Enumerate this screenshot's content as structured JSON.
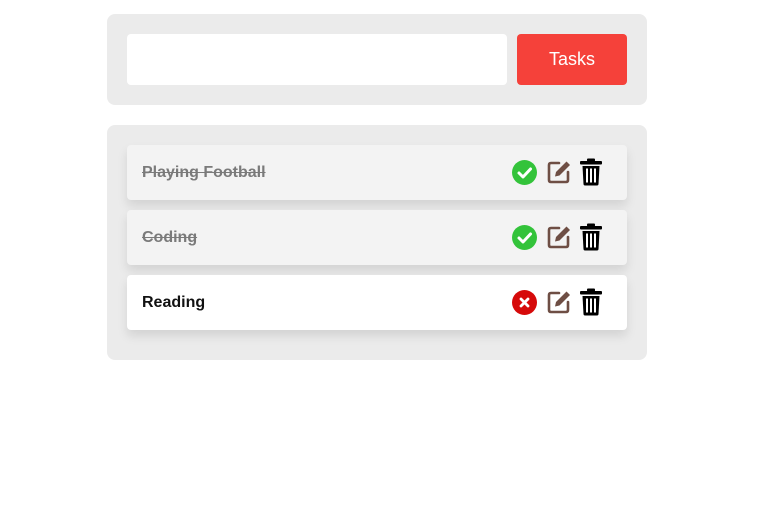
{
  "input": {
    "value": "",
    "placeholder": ""
  },
  "add_button": {
    "label": "Tasks"
  },
  "tasks": [
    {
      "text": "Playing Football",
      "status": "done",
      "status_icon": "check-circle-icon",
      "edit_icon": "edit-icon",
      "delete_icon": "trash-icon"
    },
    {
      "text": "Coding",
      "status": "done",
      "status_icon": "check-circle-icon",
      "edit_icon": "edit-icon",
      "delete_icon": "trash-icon"
    },
    {
      "text": "Reading",
      "status": "pending",
      "status_icon": "x-circle-icon",
      "edit_icon": "edit-icon",
      "delete_icon": "trash-icon"
    }
  ],
  "colors": {
    "accent": "#f5413a",
    "done_green": "#33c33a",
    "pending_red": "#d60a0a",
    "edit_brown": "#6e4e44",
    "trash_black": "#000000",
    "panel_bg": "#ebebeb"
  }
}
